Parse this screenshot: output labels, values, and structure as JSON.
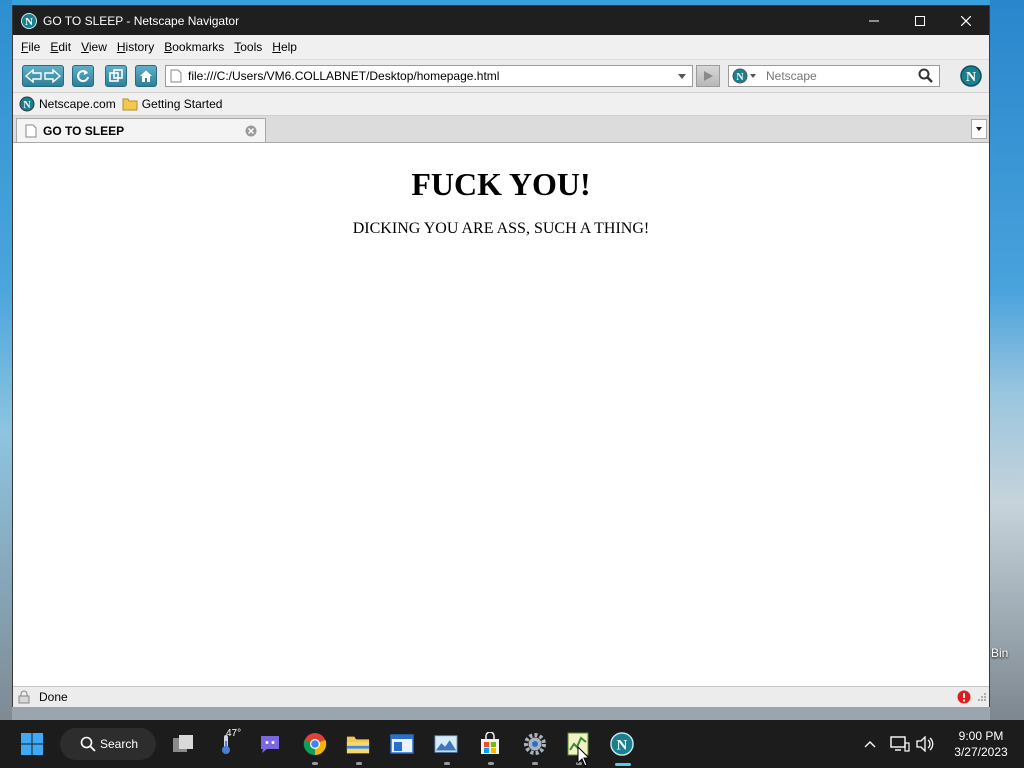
{
  "window": {
    "title": "GO TO SLEEP - Netscape Navigator"
  },
  "menu": [
    "File",
    "Edit",
    "View",
    "History",
    "Bookmarks",
    "Tools",
    "Help"
  ],
  "navbar": {
    "url": "file:///C:/Users/VM6.COLLABNET/Desktop/homepage.html",
    "search_placeholder": "Netscape"
  },
  "bookmarks": [
    {
      "label": "Netscape.com",
      "icon": "netscape-icon"
    },
    {
      "label": "Getting Started",
      "icon": "folder-icon"
    }
  ],
  "tab": {
    "label": "GO TO SLEEP"
  },
  "page": {
    "heading": "FUCK YOU!",
    "paragraph": "DICKING YOU ARE ASS, SUCH A THING!"
  },
  "status": {
    "text": "Done"
  },
  "desktop": {
    "right_label": "Bin"
  },
  "taskbar": {
    "search_label": "Search",
    "weather_temp": "47°",
    "time": "9:00 PM",
    "date": "3/27/2023"
  },
  "colors": {
    "accent": "#2f7f99",
    "titlebar": "#1f1f1f",
    "taskbar": "#1c1c1c"
  }
}
